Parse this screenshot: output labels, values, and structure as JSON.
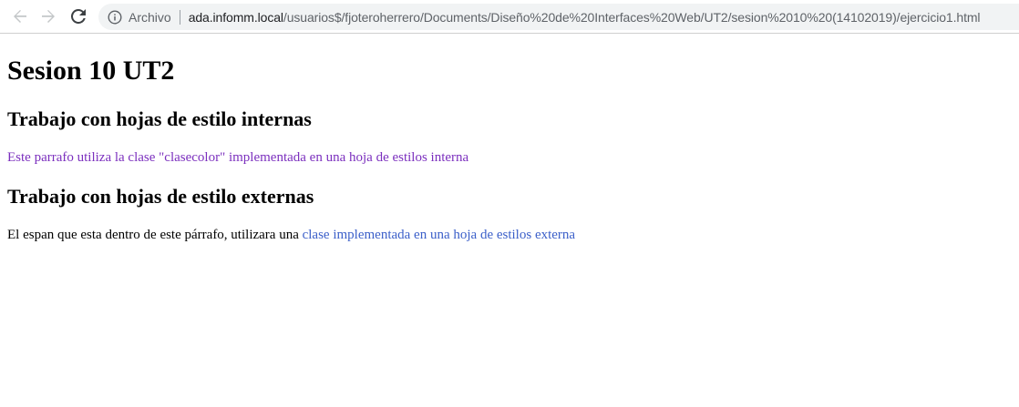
{
  "browser": {
    "nav": {
      "back_icon": "arrow-left-icon",
      "forward_icon": "arrow-right-icon",
      "reload_icon": "reload-icon"
    },
    "omnibox": {
      "security_icon": "info-icon",
      "security_label": "Archivo",
      "url_host": "ada.infomm.local",
      "url_path": "/usuarios$/fjoteroherrero/Documents/Diseño%20de%20Interfaces%20Web/UT2/sesion%2010%20(14102019)/ejercicio1.html"
    }
  },
  "page": {
    "title": "Sesion 10 UT2",
    "internal": {
      "heading": "Trabajo con hojas de estilo internas",
      "paragraph": "Este parrafo utiliza la clase \"clasecolor\" implementada en una hoja de estilos interna",
      "color": "#7b2fbe"
    },
    "external": {
      "heading": "Trabajo con hojas de estilo externas",
      "paragraph_prefix": "El espan que esta dentro de este párrafo, utilizara una ",
      "span_text": "clase implementada en una hoja de estilos externa",
      "span_color": "#3b5fc9"
    }
  }
}
